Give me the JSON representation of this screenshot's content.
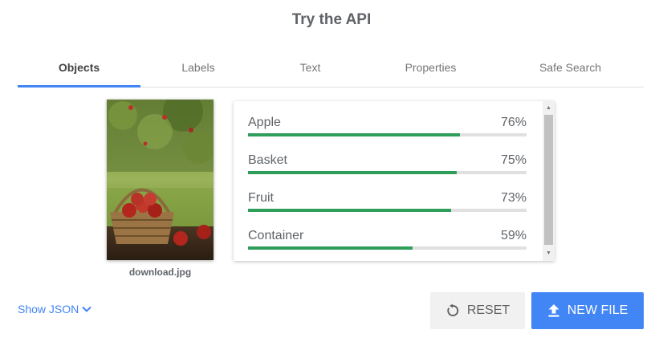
{
  "page": {
    "title": "Try the API"
  },
  "tabs": [
    {
      "label": "Objects",
      "active": true
    },
    {
      "label": "Labels",
      "active": false
    },
    {
      "label": "Text",
      "active": false
    },
    {
      "label": "Properties",
      "active": false
    },
    {
      "label": "Safe Search",
      "active": false
    }
  ],
  "image": {
    "filename": "download.jpg"
  },
  "results": [
    {
      "label": "Apple",
      "percent_text": "76%",
      "score": 0.76
    },
    {
      "label": "Basket",
      "percent_text": "75%",
      "score": 0.75
    },
    {
      "label": "Fruit",
      "percent_text": "73%",
      "score": 0.73
    },
    {
      "label": "Container",
      "percent_text": "59%",
      "score": 0.59
    }
  ],
  "actions": {
    "show_json": "Show JSON",
    "reset": "RESET",
    "new_file": "NEW FILE"
  },
  "colors": {
    "accent": "#4285f4",
    "bar": "#2e9e5b",
    "bar_track": "#e0e0e0"
  },
  "icons": {
    "show_json": "chevron-down-icon",
    "reset": "reset-icon",
    "new_file": "upload-icon"
  }
}
